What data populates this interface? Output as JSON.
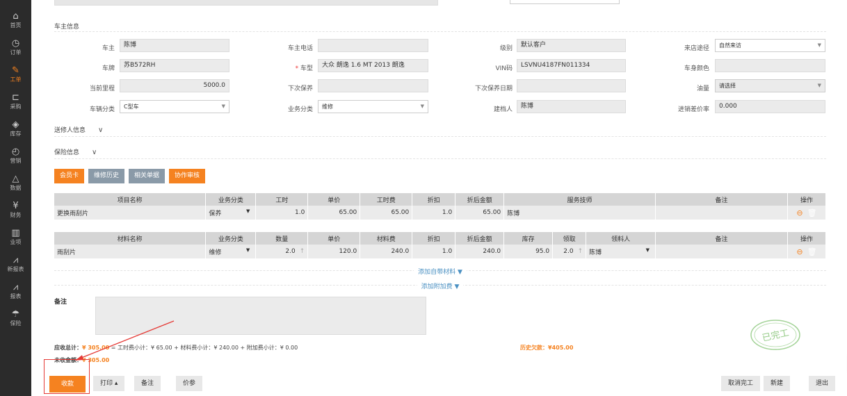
{
  "sidebar": {
    "items": [
      {
        "icon": "home-icon",
        "glyph": "⌂",
        "label": "首页"
      },
      {
        "icon": "order-icon",
        "glyph": "◷",
        "label": "订单"
      },
      {
        "icon": "wrench-icon",
        "glyph": "✎",
        "label": "工单"
      },
      {
        "icon": "cart-icon",
        "glyph": "⊏",
        "label": "采购"
      },
      {
        "icon": "box-icon",
        "glyph": "◈",
        "label": "库存"
      },
      {
        "icon": "clock-icon",
        "glyph": "◴",
        "label": "营销"
      },
      {
        "icon": "cloud-icon",
        "glyph": "△",
        "label": "数据"
      },
      {
        "icon": "yen-icon",
        "glyph": "¥",
        "label": "财务"
      },
      {
        "icon": "bar-chart-icon",
        "glyph": "▥",
        "label": "业项"
      },
      {
        "icon": "line-chart-icon",
        "glyph": "⩘",
        "label": "新报表"
      },
      {
        "icon": "report-icon",
        "glyph": "⩘",
        "label": "报表"
      },
      {
        "icon": "umbrella-icon",
        "glyph": "☂",
        "label": "保险"
      }
    ]
  },
  "owner_section": {
    "title": "车主信息",
    "owner_label": "车主",
    "owner_value": "陈博",
    "phone_label": "车主电话",
    "phone_value": "",
    "level_label": "级别",
    "level_value": "默认客户",
    "source_label": "来店途径",
    "source_value": "自然来访",
    "plate_label": "车牌",
    "plate_value": "苏B572RH",
    "model_label": "车型",
    "model_value": "大众 朗逸 1.6 MT 2013 朗逸",
    "vin_label": "VIN码",
    "vin_value": "LSVNU4187FN011334",
    "color_label": "车身颜色",
    "color_value": "",
    "mileage_label": "当前里程",
    "mileage_value": "5000.0",
    "next_service_label": "下次保养",
    "next_service_value": "",
    "next_date_label": "下次保养日期",
    "next_date_value": "",
    "oil_label": "油量",
    "oil_value": "请选择",
    "vehicle_class_label": "车辆分类",
    "vehicle_class_value": "C型车",
    "biz_class_label": "业务分类",
    "biz_class_value": "维修",
    "creator_label": "建档人",
    "creator_value": "陈博",
    "markup_label": "进销差价率",
    "markup_value": "0.000"
  },
  "sender_section": {
    "title": "送修人信息"
  },
  "insurance_section": {
    "title": "保险信息"
  },
  "action_buttons": {
    "member_card": "会员卡",
    "repair_history": "维修历史",
    "related_docs": "相关单据",
    "collab_review": "协作审核"
  },
  "labor_table": {
    "headers": [
      "项目名称",
      "业务分类",
      "工时",
      "单价",
      "工时费",
      "折扣",
      "折后金额",
      "服务技师",
      "备注",
      "操作"
    ],
    "rows": [
      {
        "name": "更换雨刮片",
        "category": "保养",
        "hours": "1.0",
        "price": "65.00",
        "fee": "65.00",
        "discount": "1.0",
        "amount": "65.00",
        "tech": "陈博",
        "note": ""
      }
    ]
  },
  "material_table": {
    "headers": [
      "材料名称",
      "业务分类",
      "数量",
      "单价",
      "材料费",
      "折扣",
      "折后金额",
      "库存",
      "领取",
      "领料人",
      "备注",
      "操作"
    ],
    "rows": [
      {
        "name": "雨刮片",
        "category": "维修",
        "qty": "2.0",
        "price": "120.0",
        "fee": "240.0",
        "discount": "1.0",
        "amount": "240.0",
        "stock": "95.0",
        "taken": "2.0",
        "receiver": "陈博",
        "note": ""
      }
    ]
  },
  "links": {
    "add_material": "添加自带材料 ▼",
    "add_fee": "添加附加费 ▼"
  },
  "remark_label": "备注",
  "totals": {
    "receivable_label": "应收总计：",
    "receivable_value": "¥ 305.00",
    "breakdown": "= 工时费小计：¥ 65.00 + 材料费小计：¥ 240.00 + 附加费小计：¥ 0.00",
    "history_debt": "历史欠款：¥405.00",
    "unpaid_label": "未收金额：",
    "unpaid_value": "¥ 305.00"
  },
  "stamp_text": "已完工",
  "bottom_buttons": {
    "pay": "收款",
    "print": "打印 ▴",
    "remark": "备注",
    "price_ref": "价参",
    "cancel_complete": "取消完工",
    "new": "新建",
    "exit": "退出"
  },
  "colors": {
    "accent": "#f58220",
    "sidebar": "#2b2b2b",
    "highlight": "#e53935"
  }
}
